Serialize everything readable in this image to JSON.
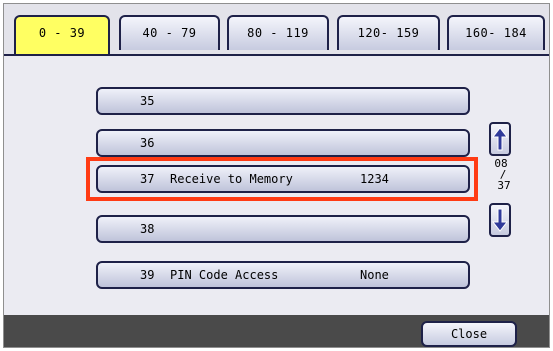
{
  "tabs": [
    {
      "label": "0 - 39",
      "active": true
    },
    {
      "label": "40 - 79",
      "active": false
    },
    {
      "label": "80 - 119",
      "active": false
    },
    {
      "label": "120- 159",
      "active": false
    },
    {
      "label": "160- 184",
      "active": false
    }
  ],
  "rows": [
    {
      "number": "35",
      "label": "",
      "value": "",
      "selected": false
    },
    {
      "number": "36",
      "label": "",
      "value": "",
      "selected": false
    },
    {
      "number": "37",
      "label": "Receive to Memory",
      "value": "1234",
      "selected": true
    },
    {
      "number": "38",
      "label": "",
      "value": "",
      "selected": false
    },
    {
      "number": "39",
      "label": "PIN Code Access",
      "value": "None",
      "selected": false
    }
  ],
  "pager": {
    "current": "08",
    "separator": "/",
    "total": "37"
  },
  "scroll": {
    "up_icon": "arrow-up-icon",
    "down_icon": "arrow-down-icon"
  },
  "footer": {
    "close_label": "Close"
  },
  "colors": {
    "active_tab": "#ffff62",
    "highlight_border": "#ff3b14",
    "button_border": "#1e2148",
    "footer_bar": "#4a4a4a"
  }
}
